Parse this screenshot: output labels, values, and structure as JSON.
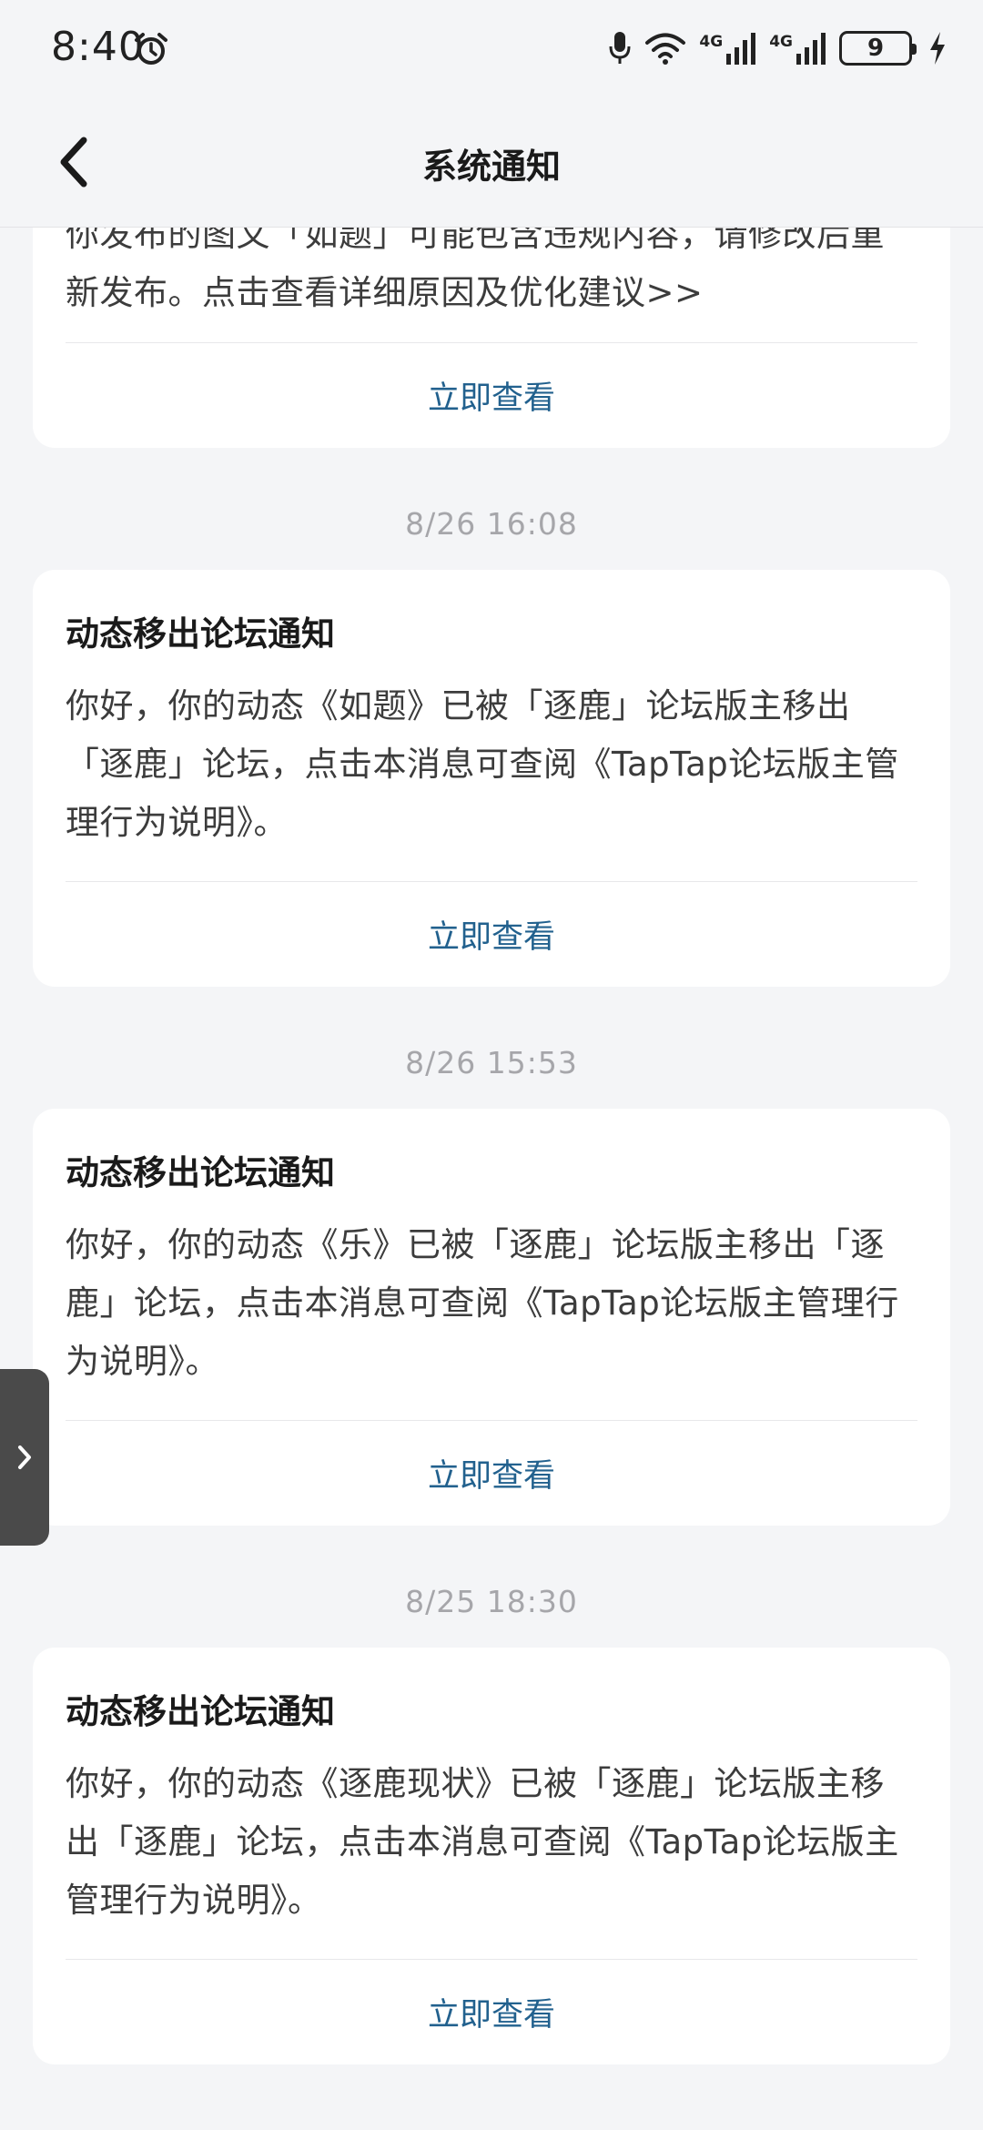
{
  "status_bar": {
    "time": "8:40",
    "battery_level": "9",
    "network_labels": [
      "4G",
      "4G"
    ]
  },
  "header": {
    "title": "系统通知"
  },
  "notifications": [
    {
      "title": "",
      "body": "你发布的图文「如题」可能包含违规内容，请修改后重新发布。点击查看详细原因及优化建议>>",
      "action": "立即查看"
    },
    {
      "timestamp": "8/26  16:08",
      "title": "动态移出论坛通知",
      "body": "你好，你的动态《如题》已被「逐鹿」论坛版主移出「逐鹿」论坛，点击本消息可查阅《TapTap论坛版主管理行为说明》。",
      "action": "立即查看"
    },
    {
      "timestamp": "8/26  15:53",
      "title": "动态移出论坛通知",
      "body": "你好，你的动态《乐》已被「逐鹿」论坛版主移出「逐鹿」论坛，点击本消息可查阅《TapTap论坛版主管理行为说明》。",
      "action": "立即查看"
    },
    {
      "timestamp": "8/25  18:30",
      "title": "动态移出论坛通知",
      "body": "你好，你的动态《逐鹿现状》已被「逐鹿」论坛版主移出「逐鹿」论坛，点击本消息可查阅《TapTap论坛版主管理行为说明》。",
      "action": "立即查看"
    }
  ],
  "icons": {
    "back": "chevron-left-icon",
    "side_tab": "chevron-right-icon",
    "alarm": "alarm-clock-icon",
    "mic": "microphone-icon",
    "wifi": "wifi-icon",
    "charging": "lightning-icon"
  },
  "colors": {
    "background": "#f4f5f7",
    "card": "#ffffff",
    "action_link": "#22618e",
    "timestamp": "#a6a6aa",
    "side_tab": "#4a4a4a"
  }
}
